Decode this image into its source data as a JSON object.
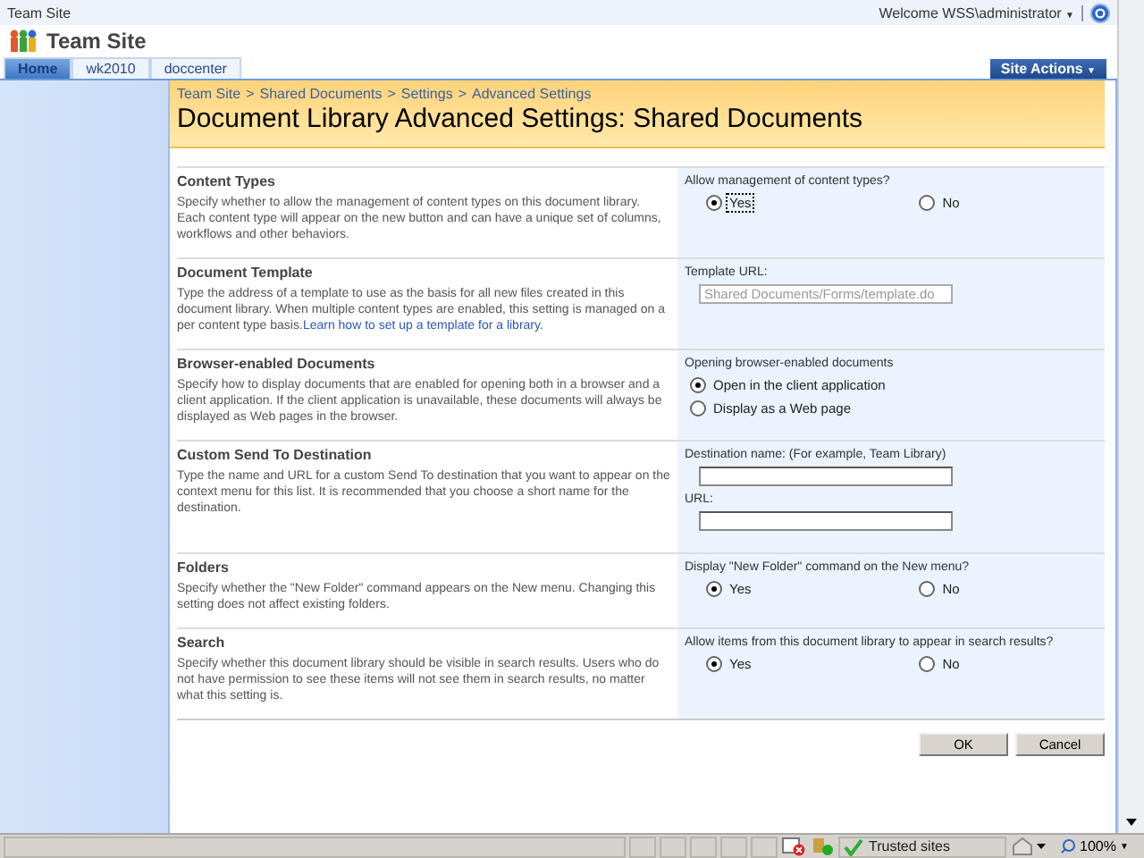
{
  "top_bar": {
    "site": "Team Site",
    "welcome": "Welcome WSS\\administrator",
    "caret": "▼"
  },
  "site_title": "Team Site",
  "tabs": [
    {
      "label": "Home",
      "selected": true
    },
    {
      "label": "wk2010",
      "selected": false
    },
    {
      "label": "doccenter",
      "selected": false
    }
  ],
  "site_actions": {
    "label": "Site Actions",
    "caret": "▼"
  },
  "breadcrumb": [
    "Team Site",
    "Shared Documents",
    "Settings",
    "Advanced Settings"
  ],
  "breadcrumb_separator": ">",
  "page_title": "Document Library Advanced Settings: Shared Documents",
  "sections": [
    {
      "kind": "radio_row",
      "title": "Content Types",
      "description": "Specify whether to allow the management of content types on this document library. Each content type will appear on the new button and can have a unique set of columns, workflows and other behaviors.",
      "prompt": "Allow management of content types?",
      "options": [
        {
          "label": "Yes",
          "selected": true,
          "focused": true
        },
        {
          "label": "No",
          "selected": false,
          "focused": false
        }
      ]
    },
    {
      "kind": "text_field",
      "title": "Document Template",
      "description": "Type the address of a template to use as the basis for all new files created in this document library. When multiple content types are enabled, this setting is managed on a per content type basis.",
      "link": "Learn how to set up a template for a library.",
      "prompt": "Template URL:",
      "value": "Shared Documents/Forms/template.do",
      "disabled": true
    },
    {
      "kind": "radio_column",
      "title": "Browser-enabled Documents",
      "description": "Specify how to display documents that are enabled for opening both in a browser and a client application. If the client application is unavailable, these documents will always be displayed as Web pages in the browser.",
      "prompt": "Opening browser-enabled documents",
      "options": [
        {
          "label": "Open in the client application",
          "selected": true,
          "focused": false
        },
        {
          "label": "Display as a Web page",
          "selected": false,
          "focused": false
        }
      ]
    },
    {
      "kind": "fields",
      "title": "Custom Send To Destination",
      "description": "Type the name and URL for a custom Send To destination that you want to appear on the context menu for this list. It is recommended that you choose a short name for the destination.",
      "fields": [
        {
          "label": "Destination name: (For example, Team Library)"
        },
        {
          "label": "URL:"
        }
      ]
    },
    {
      "kind": "radio_row",
      "title": "Folders",
      "description": "Specify whether the \"New Folder\" command appears on the New menu. Changing this setting does not affect existing folders.",
      "prompt": "Display \"New Folder\" command on the New menu?",
      "options": [
        {
          "label": "Yes",
          "selected": true,
          "focused": false
        },
        {
          "label": "No",
          "selected": false,
          "focused": false
        }
      ]
    },
    {
      "kind": "radio_row",
      "title": "Search",
      "description": "Specify whether this document library should be visible in search results. Users who do not have permission to see these items will not see them in search results, no matter what this setting is.",
      "prompt": "Allow items from this document library to appear in search results?",
      "options": [
        {
          "label": "Yes",
          "selected": true,
          "focused": false
        },
        {
          "label": "No",
          "selected": false,
          "focused": false
        }
      ]
    }
  ],
  "buttons": [
    "OK",
    "Cancel"
  ],
  "status_bar": {
    "zone": "Trusted sites",
    "zoom": "100%",
    "caret": "▼"
  }
}
